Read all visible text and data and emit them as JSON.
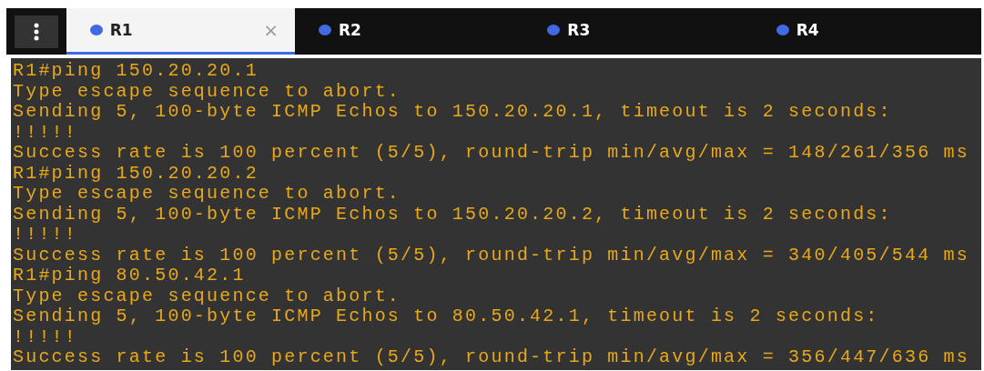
{
  "tabs": [
    {
      "label": "R1",
      "selected": true,
      "close": "×"
    },
    {
      "label": "R2",
      "selected": false
    },
    {
      "label": "R3",
      "selected": false
    },
    {
      "label": "R4",
      "selected": false
    }
  ],
  "terminal": {
    "lines": [
      "R1#ping 150.20.20.1",
      "Type escape sequence to abort.",
      "Sending 5, 100-byte ICMP Echos to 150.20.20.1, timeout is 2 seconds:",
      "!!!!!",
      "Success rate is 100 percent (5/5), round-trip min/avg/max = 148/261/356 ms",
      "R1#ping 150.20.20.2",
      "Type escape sequence to abort.",
      "Sending 5, 100-byte ICMP Echos to 150.20.20.2, timeout is 2 seconds:",
      "!!!!!",
      "Success rate is 100 percent (5/5), round-trip min/avg/max = 340/405/544 ms",
      "R1#ping 80.50.42.1",
      "Type escape sequence to abort.",
      "Sending 5, 100-byte ICMP Echos to 80.50.42.1, timeout is 2 seconds:",
      "!!!!!",
      "Success rate is 100 percent (5/5), round-trip min/avg/max = 356/447/636 ms"
    ]
  }
}
